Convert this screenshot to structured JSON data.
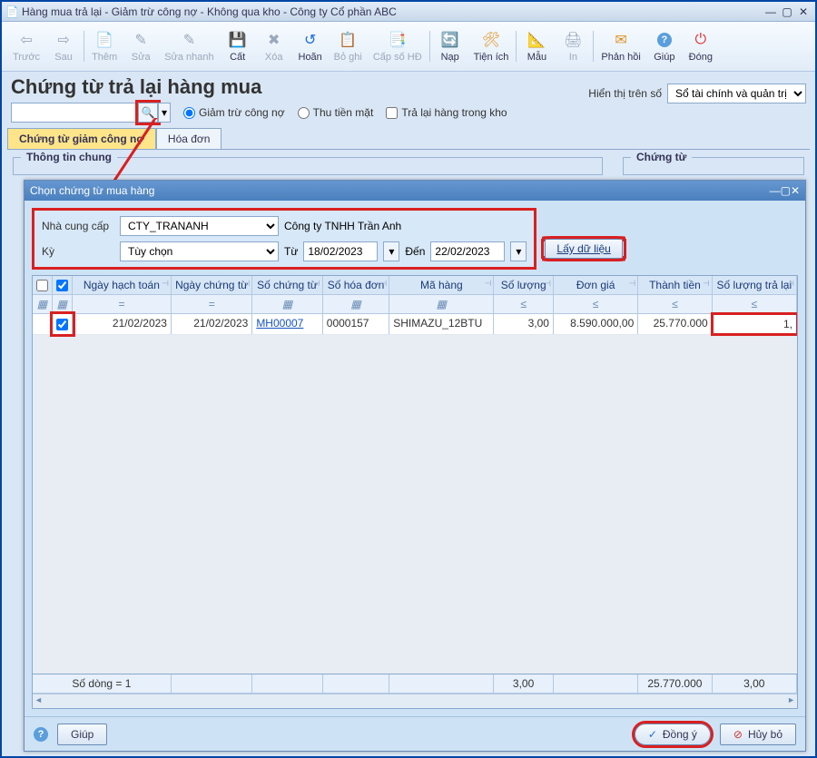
{
  "window": {
    "title": "Hàng mua trả lại - Giảm trừ công nợ - Không qua kho - Công ty Cổ phần ABC"
  },
  "toolbar": {
    "prev": "Trước",
    "next": "Sau",
    "add": "Thêm",
    "edit": "Sửa",
    "quick_edit": "Sửa nhanh",
    "cut": "Cất",
    "del": "Xóa",
    "undo": "Hoãn",
    "unpost": "Bỏ ghi",
    "assign_no": "Cấp số HĐ",
    "load": "Nạp",
    "utils": "Tiện ích",
    "template": "Mẫu",
    "print": "In",
    "feedback": "Phản hồi",
    "help": "Giúp",
    "close": "Đóng"
  },
  "page": {
    "title": "Chứng từ trả lại hàng mua"
  },
  "display_on": {
    "label": "Hiển thị trên số",
    "selected": "Sổ tài chính và quản trị"
  },
  "search": {
    "placeholder": ""
  },
  "options": {
    "giam_tru": "Giảm trừ công nợ",
    "thu_tien_mat": "Thu tiền mặt",
    "tra_lai_kho": "Trả lại hàng trong kho"
  },
  "tabs": {
    "ct": "Chứng từ giảm công nợ",
    "hd": "Hóa đơn"
  },
  "groups": {
    "info": "Thông tin chung",
    "voucher": "Chứng từ"
  },
  "dialog": {
    "title": "Chọn chứng từ mua hàng",
    "supplier_label": "Nhà cung cấp",
    "supplier_code": "CTY_TRANANH",
    "supplier_name": "Công ty TNHH Trần Anh",
    "period_label": "Kỳ",
    "period_value": "Tùy chọn",
    "from_label": "Từ",
    "from_date": "18/02/2023",
    "to_label": "Đến",
    "to_date": "22/02/2023",
    "fetch": "Lấy dữ liệu",
    "help_label": "Giúp",
    "ok": "Đồng ý",
    "cancel": "Hủy bỏ"
  },
  "grid": {
    "headers": {
      "chk": "",
      "post_date": "Ngày hạch toán",
      "doc_date": "Ngày chứng từ",
      "doc_no": "Số chứng từ",
      "inv_no": "Số hóa đơn",
      "item": "Mã hàng",
      "qty": "Số lượng",
      "price": "Đơn giá",
      "amount": "Thành tiền",
      "ret_qty": "Số lượng trả lại"
    },
    "op_eq": "=",
    "op_le": "≤",
    "row": {
      "post_date": "21/02/2023",
      "doc_date": "21/02/2023",
      "doc_no": "MH00007",
      "inv_no": "0000157",
      "item": "SHIMAZU_12BTU",
      "qty": "3,00",
      "price": "8.590.000,00",
      "amount": "25.770.000",
      "ret_qty": "1,"
    },
    "sum_label": "Số dòng = 1",
    "sum": {
      "qty": "3,00",
      "amount": "25.770.000",
      "ret_qty": "3,00"
    }
  }
}
